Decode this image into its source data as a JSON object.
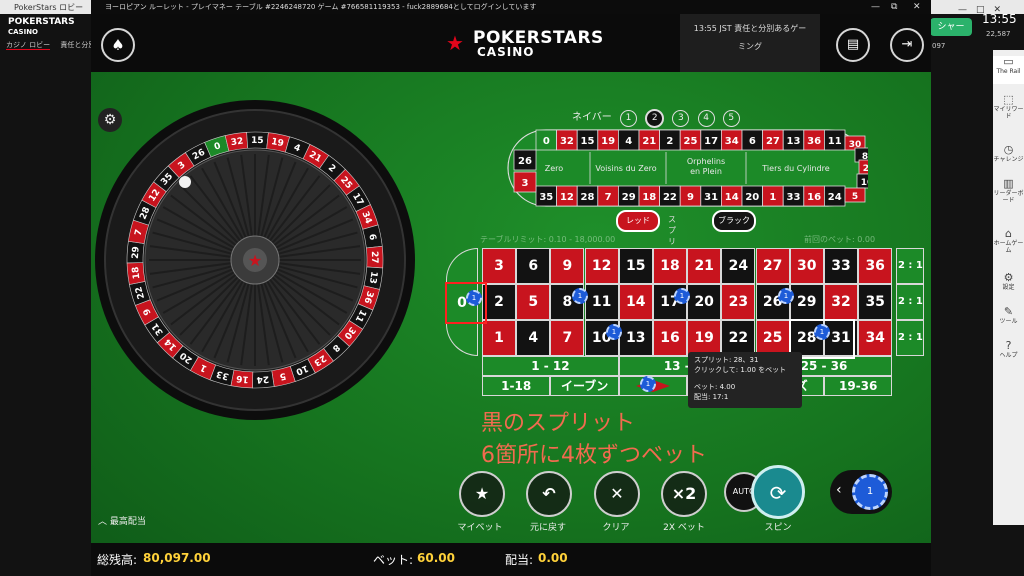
{
  "background_app": {
    "title": "PokerStars ロビー",
    "logo_top": "POKERSTARS",
    "logo_sub": "CASINO",
    "tabs": [
      "カジノ ロビー",
      "責任と分別あ"
    ],
    "balance_fragment": "097",
    "time": "13:55",
    "user_fragment": "22,587",
    "green_btn": "シャー"
  },
  "window": {
    "title": "ヨーロピアン ルーレット - プレイマネー テーブル #2246248720 ゲーム #766581119353 - fuck2889684としてログインしています",
    "controls": [
      "—",
      "⧉",
      "✕"
    ]
  },
  "topbar": {
    "brand_top": "POKERSTARS",
    "brand_sub": "CASINO",
    "session_text_1": "13:55 JST 責任と分別あるゲー",
    "session_text_2": "ミング"
  },
  "rail": {
    "items": [
      {
        "label": "The Rail",
        "icon": "rail-icon"
      },
      {
        "label": "マイリワード",
        "icon": "rewards-icon"
      },
      {
        "label": "チャレンジ",
        "icon": "challenge-icon"
      },
      {
        "label": "リーダーボード",
        "icon": "leaderboard-icon"
      },
      {
        "label": "ホームゲーム",
        "icon": "home-icon"
      },
      {
        "label": "設定",
        "icon": "settings-icon"
      },
      {
        "label": "ツール",
        "icon": "tools-icon"
      },
      {
        "label": "ヘルプ",
        "icon": "help-icon"
      }
    ]
  },
  "wheel": {
    "numbers": [
      "0",
      "32",
      "15",
      "19",
      "4",
      "21",
      "2",
      "25",
      "17",
      "34",
      "6",
      "27",
      "13",
      "36",
      "11",
      "30",
      "8",
      "23",
      "10",
      "5",
      "24",
      "16",
      "33",
      "1",
      "20",
      "14",
      "31",
      "9",
      "22",
      "18",
      "29",
      "7",
      "28",
      "12",
      "35",
      "3",
      "26"
    ]
  },
  "neighbors": {
    "label": "ネイバー",
    "options": [
      "1",
      "2",
      "3",
      "4",
      "5"
    ],
    "selected": "2"
  },
  "racetrack": {
    "top_row": [
      "0",
      "32",
      "15",
      "19",
      "4",
      "21",
      "2",
      "25",
      "17",
      "34",
      "6",
      "27",
      "13",
      "36",
      "11"
    ],
    "bottom_row": [
      "35",
      "12",
      "28",
      "7",
      "29",
      "18",
      "22",
      "9",
      "31",
      "14",
      "20",
      "1",
      "33",
      "16",
      "24"
    ],
    "left": [
      "26",
      "3"
    ],
    "right": [
      "30",
      "8",
      "23",
      "10",
      "5"
    ],
    "sections": [
      "Zero",
      "Voisins du Zero",
      "Orphelins en Plein",
      "Tiers du Cylindre"
    ]
  },
  "color_toggle": {
    "red": "レッド",
    "split": "スプリット",
    "black": "ブラック"
  },
  "table_limit": "テーブルリミット: 0.10 - 18,000.00",
  "last_bet": "前回のベット: 0.00",
  "board": {
    "zero": "0",
    "rows": [
      [
        "3",
        "6",
        "9",
        "12",
        "15",
        "18",
        "21",
        "24",
        "27",
        "30",
        "33",
        "36"
      ],
      [
        "2",
        "5",
        "8",
        "11",
        "14",
        "17",
        "20",
        "23",
        "26",
        "29",
        "32",
        "35"
      ],
      [
        "1",
        "4",
        "7",
        "10",
        "13",
        "16",
        "19",
        "22",
        "25",
        "28",
        "31",
        "34"
      ]
    ],
    "column_bets": [
      "2 : 1",
      "2 : 1",
      "2 : 1"
    ],
    "dozens": [
      "1 - 12",
      "13 - 24",
      "25 - 36"
    ],
    "even_money": [
      "1-18",
      "イーブン",
      "",
      "",
      "オッズ",
      "19-36"
    ],
    "chip_value": "1"
  },
  "tooltip": {
    "line1": "スプリット: 28、31",
    "line2": "クリックして: 1.00 をベット",
    "line3": "ベット: 4.00",
    "line4": "配当: 17:1"
  },
  "overlay": {
    "line1": "黒のスプリット",
    "line2": "6箇所に4枚ずつベット"
  },
  "controls": {
    "my_bet": "マイベット",
    "undo": "元に戻す",
    "clear": "クリア",
    "double": "2X ベット",
    "double_icon": "×2",
    "spin": "スピン",
    "auto": "AUTO",
    "chip": "1"
  },
  "high_payout": "最高配当",
  "bottom": {
    "balance_label": "総残高:",
    "balance": "80,097.00",
    "bet_label": "ベット:",
    "bet": "60.00",
    "payout_label": "配当:",
    "payout": "0.00"
  },
  "colors": {
    "red": "#c8141e",
    "black": "#121212",
    "felt": "#1c8a28",
    "chip": "#1d5bd8"
  }
}
